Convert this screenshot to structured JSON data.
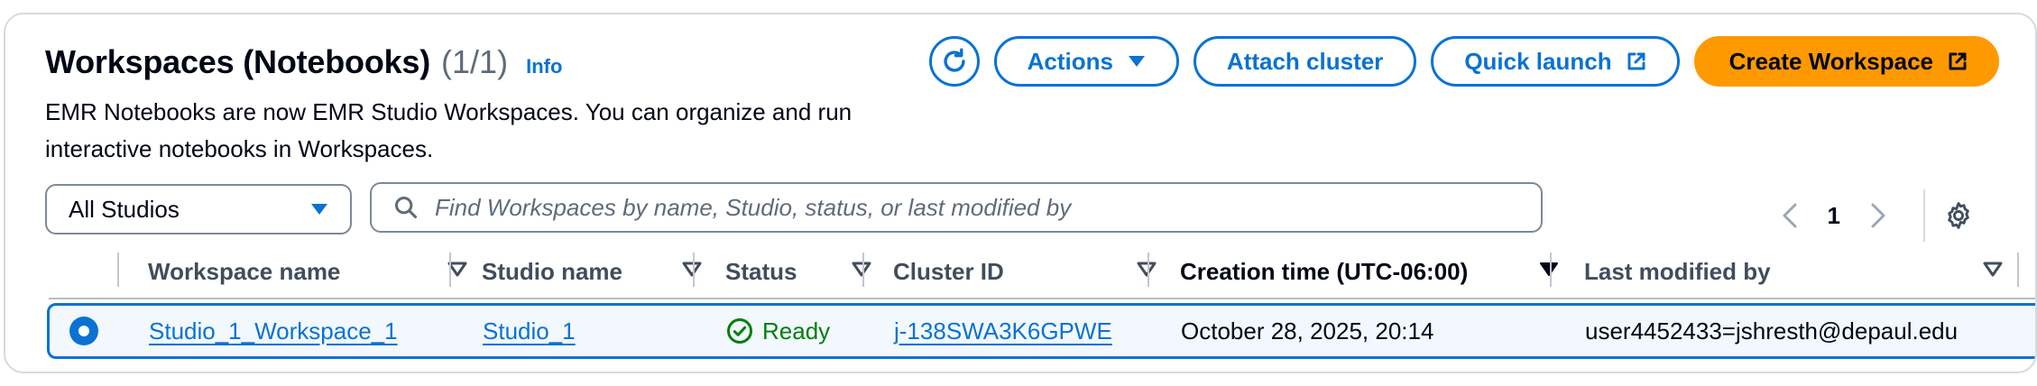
{
  "header": {
    "title": "Workspaces (Notebooks)",
    "count": "(1/1)",
    "info_label": "Info",
    "description": "EMR Notebooks are now EMR Studio Workspaces. You can organize and run interactive notebooks in Workspaces."
  },
  "toolbar": {
    "refresh_icon": "refresh-icon",
    "actions_label": "Actions",
    "attach_label": "Attach cluster",
    "quick_launch_label": "Quick launch",
    "create_label": "Create Workspace"
  },
  "filters": {
    "studio_select_value": "All Studios",
    "search_placeholder": "Find Workspaces by name, Studio, status, or last modified by"
  },
  "pagination": {
    "current_page": "1"
  },
  "table": {
    "columns": [
      "Workspace name",
      "Studio name",
      "Status",
      "Cluster ID",
      "Creation time (UTC-06:00)",
      "Last modified by"
    ],
    "rows": [
      {
        "workspace_name": "Studio_1_Workspace_1",
        "studio_name": "Studio_1",
        "status": "Ready",
        "cluster_id": "j-138SWA3K6GPWE",
        "creation_time": "October 28, 2025, 20:14",
        "last_modified_by": "user4452433=jshresth@depaul.edu",
        "selected": true
      }
    ]
  },
  "colors": {
    "accent": "#0972d3",
    "primary_button": "#ff9900",
    "success": "#037f0c",
    "selected_row_bg": "#f2f8fd",
    "border": "#d5dbdb"
  }
}
